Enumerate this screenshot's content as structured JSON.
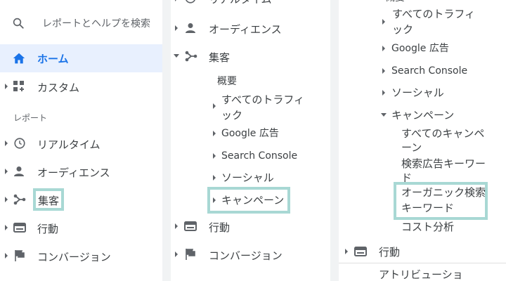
{
  "panel1": {
    "search_placeholder": "レポートとヘルプを検索",
    "home": "ホーム",
    "custom": "カスタム",
    "section_reports": "レポート",
    "realtime": "リアルタイム",
    "audience": "オーディエンス",
    "acquisition": "集客",
    "behavior": "行動",
    "conversions": "コンバージョン"
  },
  "panel2": {
    "realtime": "リアルタイム",
    "audience": "オーディエンス",
    "acquisition": "集客",
    "overview": "概要",
    "all_traffic_1": "すべてのトラフィ",
    "all_traffic_2": "ック",
    "google_ads": "Google 広告",
    "search_console": "Search Console",
    "social": "ソーシャル",
    "campaigns": "キャンペーン",
    "behavior": "行動",
    "conversions": "コンバージョン"
  },
  "panel3": {
    "top_clipped": "概要",
    "all_traffic_1": "すべてのトラフィ",
    "all_traffic_2": "ック",
    "google_ads": "Google 広告",
    "search_console": "Search Console",
    "social": "ソーシャル",
    "campaigns": "キャンペーン",
    "all_campaigns_1": "すべてのキャンペ",
    "all_campaigns_2": "ーン",
    "paid_keywords_1": "検索広告キーワー",
    "paid_keywords_2": "ド",
    "organic_keywords_1": "オーガニック検索",
    "organic_keywords_2": "キーワード",
    "cost_analysis": "コスト分析",
    "behavior": "行動",
    "attribution": "アトリビューショ"
  },
  "colors": {
    "accent": "#1a73e8",
    "active_bg": "#e8f0fe",
    "highlight": "#a8d8d4",
    "text": "#3c4043",
    "icon": "#5f6368"
  },
  "icons": [
    "search-icon",
    "home-icon",
    "dashboard-icon",
    "clock-icon",
    "person-icon",
    "acquisition-icon",
    "behavior-icon",
    "flag-icon"
  ]
}
